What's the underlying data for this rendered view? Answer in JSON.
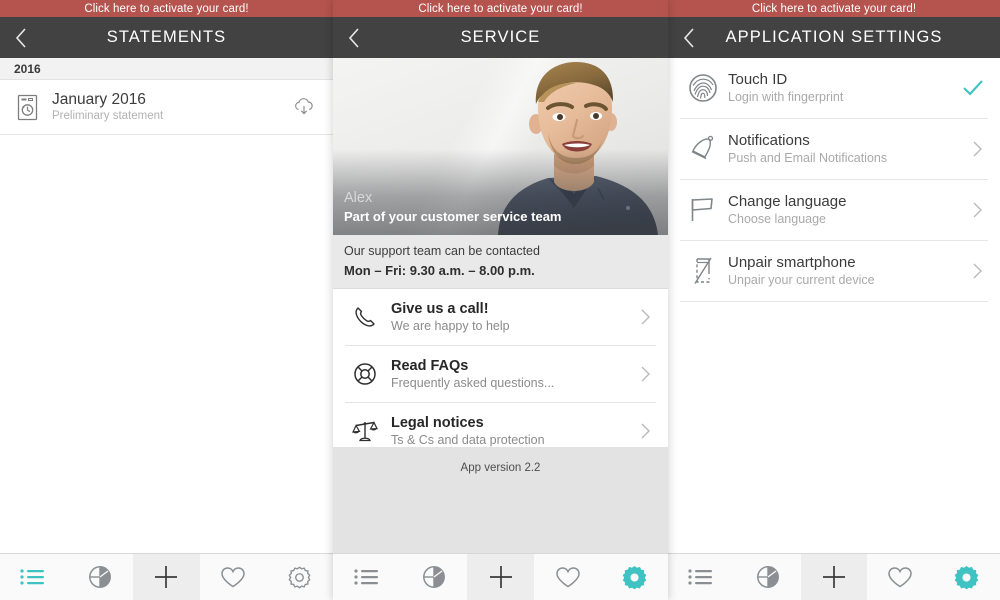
{
  "banner": {
    "text": "Click here to activate your card!"
  },
  "colors": {
    "banner_red": "#b5544f",
    "navbar_dark": "#424242",
    "accent_teal": "#3fc2c2",
    "section_gray": "#f2f2f2",
    "support_gray": "#e9e9e9",
    "footer_gray": "#e3e3e3"
  },
  "screens": [
    {
      "id": "statements",
      "nav": {
        "title": "STATEMENTS",
        "back_icon": "chevron-left-icon"
      },
      "section_header": "2016",
      "rows": [
        {
          "icon": "statement-document-icon",
          "title": "January 2016",
          "subtitle": "Preliminary statement",
          "action_icon": "cloud-download-icon"
        }
      ],
      "tabs": [
        {
          "icon": "list-icon",
          "state": "active"
        },
        {
          "icon": "pie-chart-icon",
          "state": "normal"
        },
        {
          "icon": "plus-icon",
          "state": "raised"
        },
        {
          "icon": "heart-icon",
          "state": "normal"
        },
        {
          "icon": "gear-icon",
          "state": "normal"
        }
      ]
    },
    {
      "id": "service",
      "nav": {
        "title": "SERVICE",
        "back_icon": "chevron-left-icon"
      },
      "hero": {
        "name": "Alex",
        "role": "Part of your customer service team"
      },
      "support": {
        "line1": "Our support team can be contacted",
        "line2": "Mon – Fri: 9.30 a.m. – 8.00 p.m."
      },
      "rows": [
        {
          "icon": "phone-icon",
          "title": "Give us a call!",
          "subtitle": "We are happy to help",
          "chevron": "chevron-right-icon"
        },
        {
          "icon": "lifebuoy-icon",
          "title": "Read FAQs",
          "subtitle": "Frequently asked questions...",
          "chevron": "chevron-right-icon"
        },
        {
          "icon": "scales-icon",
          "title": "Legal notices",
          "subtitle": "Ts & Cs and data protection",
          "chevron": "chevron-right-icon"
        }
      ],
      "version": "App version 2.2",
      "tabs": [
        {
          "icon": "list-icon",
          "state": "normal"
        },
        {
          "icon": "pie-chart-icon",
          "state": "normal"
        },
        {
          "icon": "plus-icon",
          "state": "raised"
        },
        {
          "icon": "heart-icon",
          "state": "normal"
        },
        {
          "icon": "gear-icon",
          "state": "active"
        }
      ]
    },
    {
      "id": "application-settings",
      "nav": {
        "title": "APPLICATION SETTINGS",
        "back_icon": "chevron-left-icon"
      },
      "rows": [
        {
          "icon": "fingerprint-icon",
          "title": "Touch ID",
          "subtitle": "Login with fingerprint",
          "accessory": "check-icon"
        },
        {
          "icon": "bell-icon",
          "title": "Notifications",
          "subtitle": "Push and Email Notifications",
          "accessory": "chevron-right-icon"
        },
        {
          "icon": "flag-icon",
          "title": "Change language",
          "subtitle": "Choose language",
          "accessory": "chevron-right-icon"
        },
        {
          "icon": "smartphone-unpair-icon",
          "title": "Unpair smartphone",
          "subtitle": "Unpair your current device",
          "accessory": "chevron-right-icon"
        }
      ],
      "tabs": [
        {
          "icon": "list-icon",
          "state": "normal"
        },
        {
          "icon": "pie-chart-icon",
          "state": "normal"
        },
        {
          "icon": "plus-icon",
          "state": "raised"
        },
        {
          "icon": "heart-icon",
          "state": "normal"
        },
        {
          "icon": "gear-icon",
          "state": "active"
        }
      ]
    }
  ]
}
